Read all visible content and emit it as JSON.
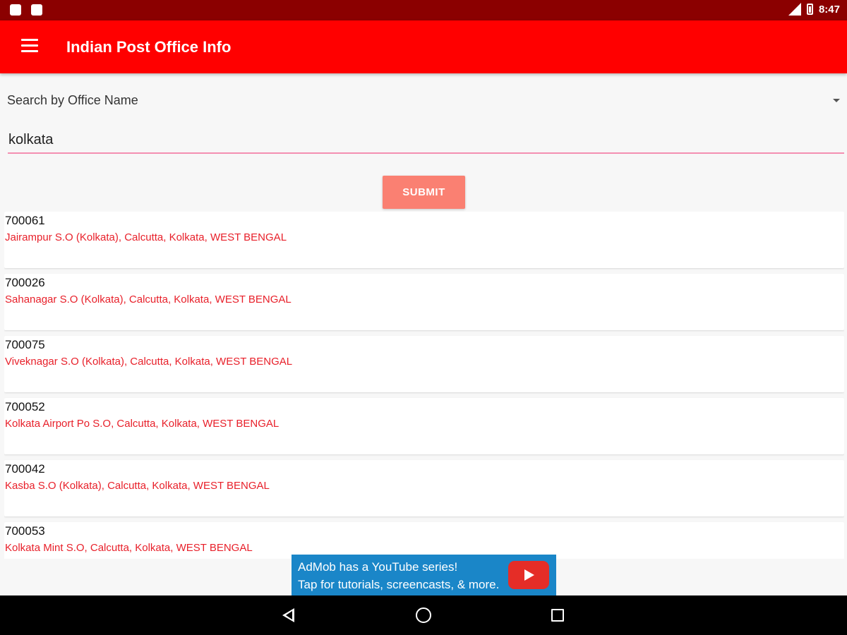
{
  "status_bar": {
    "time": "8:47",
    "icons": [
      "notification-icon",
      "notification-icon",
      "signal-icon",
      "battery-icon"
    ]
  },
  "app_bar": {
    "title": "Indian Post Office Info",
    "menu_icon": "menu-icon"
  },
  "search": {
    "mode_selected": "Search by Office Name",
    "query": "kolkata",
    "submit_label": "SUBMIT"
  },
  "results": [
    {
      "pincode": "700061",
      "address": "Jairampur S.O (Kolkata), Calcutta, Kolkata, WEST BENGAL"
    },
    {
      "pincode": "700026",
      "address": "Sahanagar S.O (Kolkata), Calcutta, Kolkata, WEST BENGAL"
    },
    {
      "pincode": "700075",
      "address": "Viveknagar S.O (Kolkata), Calcutta, Kolkata, WEST BENGAL"
    },
    {
      "pincode": "700052",
      "address": "Kolkata Airport  Po S.O, Calcutta, Kolkata, WEST BENGAL"
    },
    {
      "pincode": "700042",
      "address": "Kasba S.O (Kolkata), Calcutta, Kolkata, WEST BENGAL"
    },
    {
      "pincode": "700053",
      "address": "Kolkata Mint S.O, Calcutta, Kolkata, WEST BENGAL"
    }
  ],
  "ad": {
    "line1": "AdMob has a YouTube series!",
    "line2": "Tap for tutorials, screencasts, & more.",
    "icon": "youtube-play-icon"
  },
  "colors": {
    "status_bar": "#8b0000",
    "app_bar": "#ff0000",
    "accent": "#fa8072",
    "address_text": "#e8202a",
    "input_underline": "#f48fb1",
    "ad_background": "#1a86c8"
  }
}
